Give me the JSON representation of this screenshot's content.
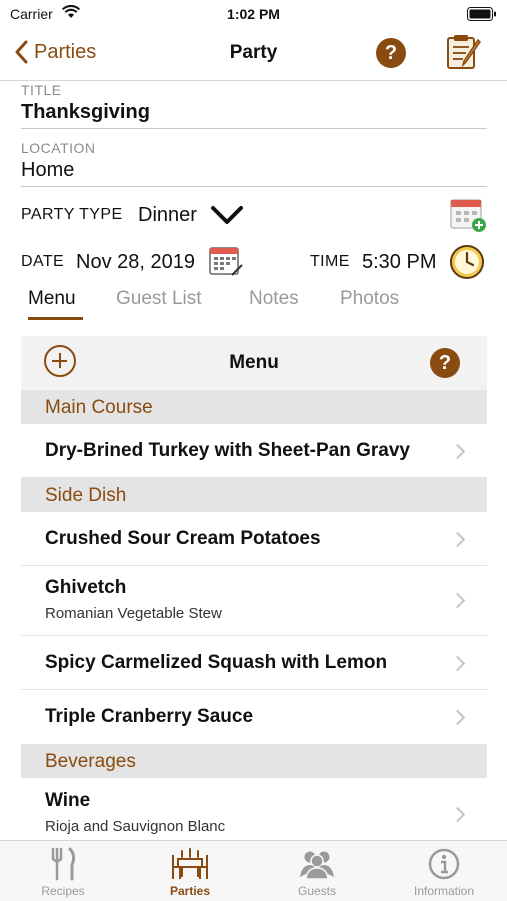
{
  "status_bar": {
    "carrier": "Carrier",
    "time": "1:02 PM"
  },
  "nav": {
    "back_label": "Parties",
    "title": "Party",
    "help": "?"
  },
  "form": {
    "title_label": "TITLE",
    "title_value": "Thanksgiving",
    "location_label": "LOCATION",
    "location_value": "Home",
    "party_type_label": "PARTY TYPE",
    "party_type_value": "Dinner",
    "date_label": "DATE",
    "date_value": "Nov 28, 2019",
    "time_label": "TIME",
    "time_value": "5:30 PM"
  },
  "tabs": [
    {
      "label": "Menu",
      "active": true
    },
    {
      "label": "Guest List",
      "active": false
    },
    {
      "label": "Notes",
      "active": false
    },
    {
      "label": "Photos",
      "active": false
    }
  ],
  "menu_panel": {
    "title": "Menu",
    "help": "?",
    "sections": [
      {
        "title": "Main Course",
        "items": [
          {
            "name": "Dry-Brined Turkey with Sheet-Pan Gravy",
            "subtitle": ""
          }
        ]
      },
      {
        "title": "Side Dish",
        "items": [
          {
            "name": "Crushed Sour Cream Potatoes",
            "subtitle": ""
          },
          {
            "name": "Ghivetch",
            "subtitle": "Romanian Vegetable Stew"
          },
          {
            "name": "Spicy Carmelized Squash with Lemon",
            "subtitle": ""
          },
          {
            "name": "Triple Cranberry Sauce",
            "subtitle": ""
          }
        ]
      },
      {
        "title": "Beverages",
        "items": [
          {
            "name": "Wine",
            "subtitle": "Rioja and Sauvignon Blanc"
          }
        ]
      }
    ]
  },
  "tab_bar": [
    {
      "label": "Recipes",
      "icon": "fork-knife-icon",
      "active": false
    },
    {
      "label": "Parties",
      "icon": "dining-table-icon",
      "active": true
    },
    {
      "label": "Guests",
      "icon": "people-icon",
      "active": false
    },
    {
      "label": "Information",
      "icon": "info-icon",
      "active": false
    }
  ],
  "colors": {
    "accent": "#8a4b10",
    "section_bg": "#e4e4e4",
    "panel_bg": "#f2f2f2",
    "inactive": "#9a9a9a"
  }
}
